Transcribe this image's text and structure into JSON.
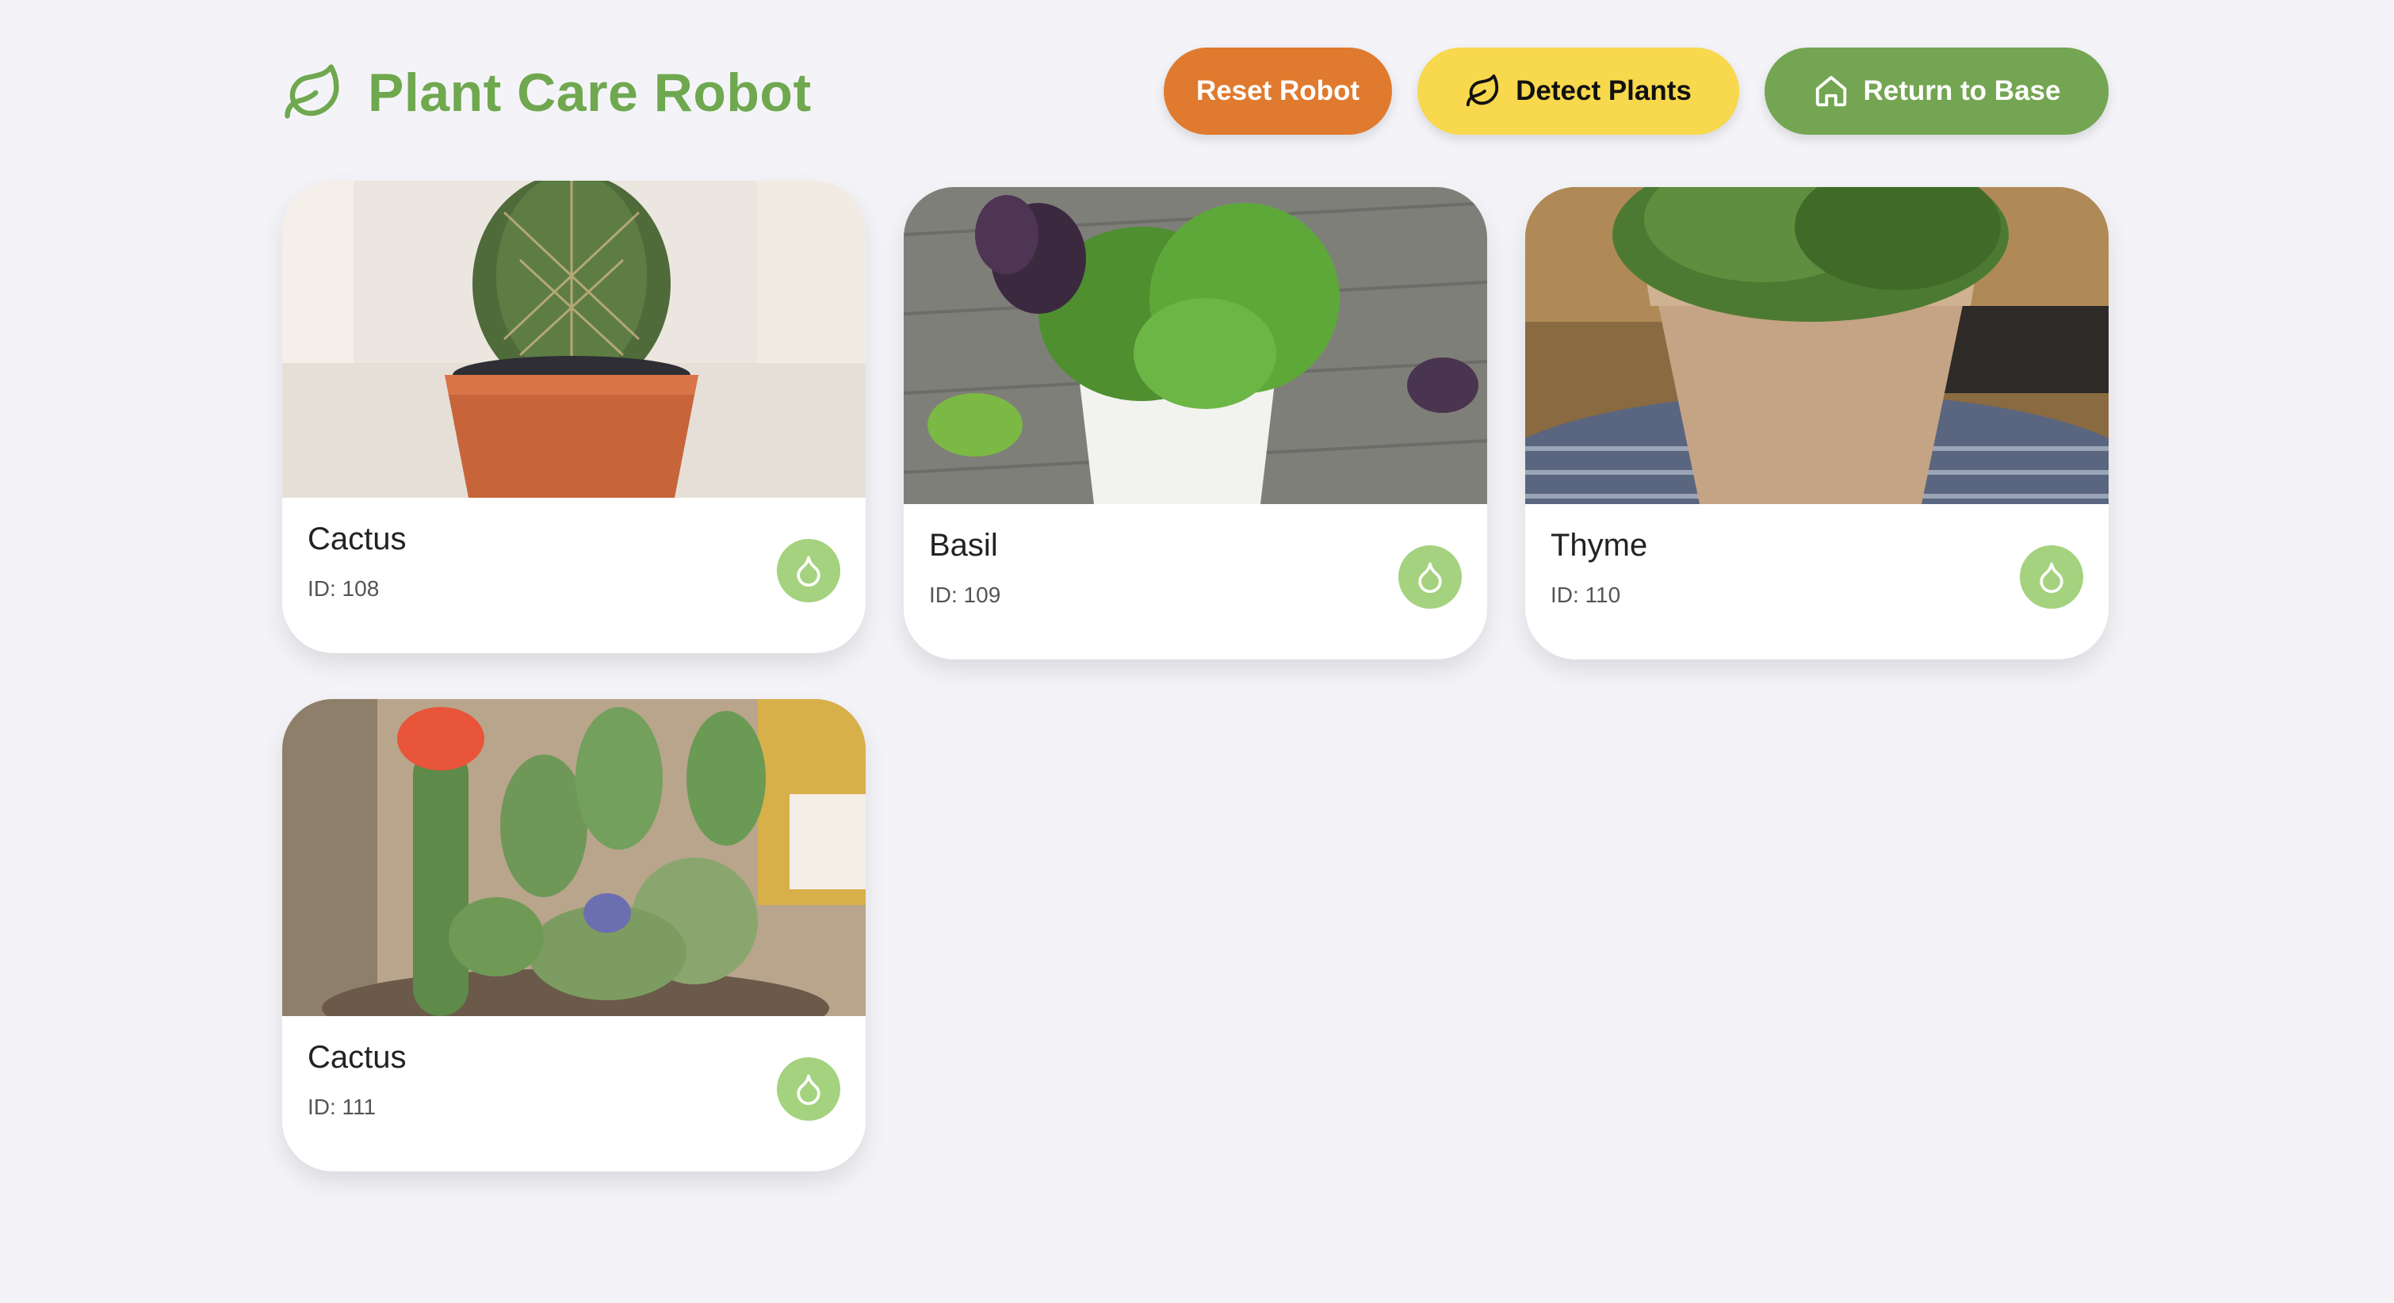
{
  "app": {
    "title": "Plant Care Robot",
    "brand_icon": "leaf-icon"
  },
  "actions": {
    "reset_label": "Reset Robot",
    "detect_label": "Detect Plants",
    "detect_icon": "leaf-icon",
    "return_label": "Return to Base",
    "return_icon": "home-icon"
  },
  "colors": {
    "page_background": "#f4f4f8",
    "brand_green": "#6fa84f",
    "reset_orange": "#e07a2e",
    "detect_yellow": "#f8d84c",
    "return_green": "#74a552",
    "water_button": "#a4d27e"
  },
  "plants": [
    {
      "name": "Cactus",
      "id_label": "ID: 108",
      "action_icon": "water-drop-icon"
    },
    {
      "name": "Basil",
      "id_label": "ID: 109",
      "action_icon": "water-drop-icon"
    },
    {
      "name": "Thyme",
      "id_label": "ID: 110",
      "action_icon": "water-drop-icon"
    },
    {
      "name": "Cactus",
      "id_label": "ID: 111",
      "action_icon": "water-drop-icon"
    }
  ]
}
